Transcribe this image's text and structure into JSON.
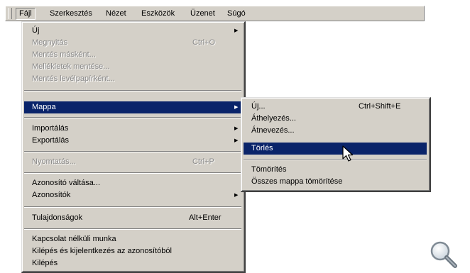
{
  "menubar": {
    "items": [
      "Fájl",
      "Szerkesztés",
      "Nézet",
      "Eszközök",
      "Üzenet",
      "Súgó"
    ]
  },
  "file_menu": {
    "new": "Új",
    "open": "Megnyitás",
    "open_shortcut": "Ctrl+O",
    "save_as": "Mentés másként...",
    "save_attachments": "Mellékletek mentése...",
    "save_stationery": "Mentés levélpapírként...",
    "folder": "Mappa",
    "import": "Importálás",
    "export": "Exportálás",
    "print": "Nyomtatás...",
    "print_shortcut": "Ctrl+P",
    "switch_identity": "Azonosító váltása...",
    "identities": "Azonosítók",
    "properties": "Tulajdonságok",
    "properties_shortcut": "Alt+Enter",
    "offline": "Kapcsolat nélküli munka",
    "exit_logoff": "Kilépés és kijelentkezés az azonosítóból",
    "exit": "Kilépés"
  },
  "folder_submenu": {
    "new": "Új...",
    "new_shortcut": "Ctrl+Shift+E",
    "move": "Áthelyezés...",
    "rename": "Átnevezés...",
    "delete": "Törlés",
    "compact": "Tömörítés",
    "compact_all": "Összes mappa tömörítése"
  },
  "colors": {
    "menu_bg": "#d4d0c8",
    "highlight": "#0a246a",
    "disabled": "#8a8a8a"
  },
  "icons": [
    "submenu-arrow-icon",
    "mouse-pointer-icon",
    "magnifier-icon"
  ]
}
